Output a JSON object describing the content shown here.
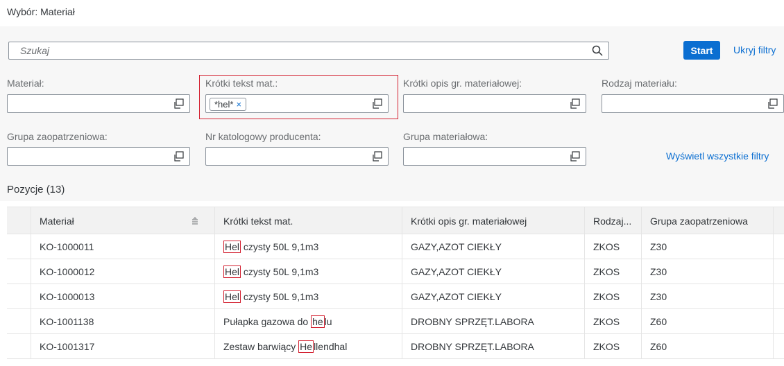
{
  "page": {
    "title": "Wybór: Materiał"
  },
  "search": {
    "placeholder": "Szukaj",
    "icon": "search-icon"
  },
  "actions": {
    "start": "Start",
    "hide_filters": "Ukryj filtry",
    "show_all_filters": "Wyświetl wszystkie filtry"
  },
  "filters": {
    "material": {
      "label": "Materiał:",
      "value": ""
    },
    "short_text": {
      "label": "Krótki tekst mat.:",
      "token": "*hel*",
      "token_remove": "×"
    },
    "short_group_desc": {
      "label": "Krótki opis gr. materiałowej:",
      "value": ""
    },
    "material_type": {
      "label": "Rodzaj materiału:",
      "value": ""
    },
    "purchasing_group": {
      "label": "Grupa zaopatrzeniowa:",
      "value": ""
    },
    "catalog_number": {
      "label": "Nr katologowy producenta:",
      "value": ""
    },
    "material_group": {
      "label": "Grupa materiałowa:",
      "value": ""
    }
  },
  "table": {
    "title": "Pozycje (13)",
    "columns": [
      "Materiał",
      "Krótki tekst mat.",
      "Krótki opis gr. materiałowej",
      "Rodzaj...",
      "Grupa zaopatrzeniowa"
    ],
    "rows": [
      {
        "material": "KO-1000011",
        "text_pre": "",
        "text_hl": "Hel",
        "text_post": " czysty 50L 9,1m3",
        "group_desc": "GAZY,AZOT CIEKŁY",
        "type": "ZKOS",
        "purch": "Z30"
      },
      {
        "material": "KO-1000012",
        "text_pre": "",
        "text_hl": "Hel",
        "text_post": " czysty 50L 9,1m3",
        "group_desc": "GAZY,AZOT CIEKŁY",
        "type": "ZKOS",
        "purch": "Z30"
      },
      {
        "material": "KO-1000013",
        "text_pre": "",
        "text_hl": "Hel",
        "text_post": " czysty 50L 9,1m3",
        "group_desc": "GAZY,AZOT CIEKŁY",
        "type": "ZKOS",
        "purch": "Z30"
      },
      {
        "material": "KO-1001138",
        "text_pre": "Pułapka gazowa do ",
        "text_hl": "he",
        "text_post": "lu",
        "group_desc": "DROBNY SPRZĘT.LABORA",
        "type": "ZKOS",
        "purch": "Z60"
      },
      {
        "material": "KO-1001317",
        "text_pre": "Zestaw barwiący ",
        "text_hl": "He",
        "text_post": "llendhal",
        "group_desc": "DROBNY SPRZĘT.LABORA",
        "type": "ZKOS",
        "purch": "Z60"
      }
    ]
  },
  "colors": {
    "accent": "#0a6ed1",
    "highlight": "#d32030",
    "filterbar_bg": "#f7f7f7"
  }
}
